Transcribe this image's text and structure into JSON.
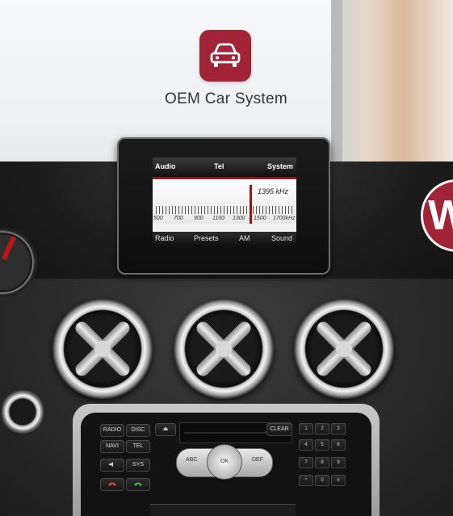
{
  "app": {
    "title": "OEM Car System",
    "icon": "car-icon",
    "accent_color": "#a32336",
    "partial_badge_text": "W"
  },
  "head_unit": {
    "top_tabs": [
      "Audio",
      "Tel",
      "System"
    ],
    "frequency": "1395 kHz",
    "scale_labels": [
      "500",
      "700",
      "900",
      "1100",
      "1300",
      "1500",
      "1700kHz"
    ],
    "bottom_tabs": [
      "Radio",
      "Presets",
      "AM",
      "Sound"
    ]
  },
  "radio_panel": {
    "left_buttons": [
      "RADIO",
      "DISC",
      "NAVI",
      "TEL",
      "SYS"
    ],
    "eject_label": "⏏",
    "clear_label": "CLEAR",
    "knob_left": "ABC",
    "knob_center": "OK",
    "knob_right": "DEF",
    "keypad": [
      "1",
      "2",
      "3",
      "4",
      "5",
      "6",
      "7",
      "8",
      "9",
      "*",
      "0",
      "#"
    ]
  }
}
